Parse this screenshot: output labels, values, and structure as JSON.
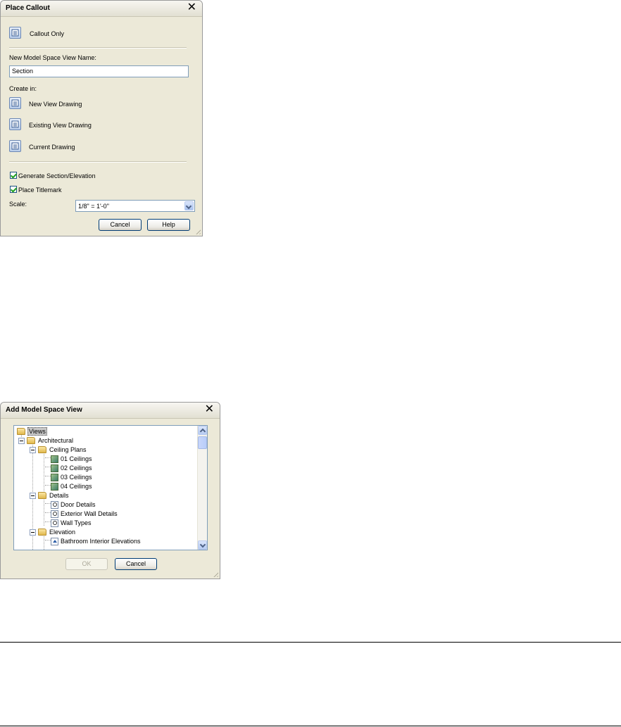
{
  "place_callout": {
    "title": "Place Callout",
    "callout_only_label": "Callout Only",
    "view_name_label": "New Model Space View Name:",
    "view_name_value": "Section",
    "create_in_label": "Create in:",
    "create_options": [
      "New View Drawing",
      "Existing View Drawing",
      "Current Drawing"
    ],
    "generate_section_label": "Generate Section/Elevation",
    "generate_section_checked": true,
    "place_titlemark_label": "Place Titlemark",
    "place_titlemark_checked": true,
    "scale_label": "Scale:",
    "scale_value": "1/8\" = 1'-0\"",
    "cancel_label": "Cancel",
    "help_label": "Help"
  },
  "add_view": {
    "title": "Add Model Space View",
    "tree": {
      "root": "Views",
      "architectural": "Architectural",
      "ceiling_plans": "Ceiling Plans",
      "ceilings": [
        "01 Ceilings",
        "02 Ceilings",
        "03 Ceilings",
        "04 Ceilings"
      ],
      "details": "Details",
      "detail_items": [
        "Door Details",
        "Exterior Wall Details",
        "Wall Types"
      ],
      "elevation": "Elevation",
      "elevation_items": [
        "Bathroom Interior Elevations"
      ]
    },
    "ok_label": "OK",
    "ok_enabled": false,
    "cancel_label": "Cancel"
  },
  "icons": {
    "close": "close-icon",
    "view_drawing": "view-drawing-icon",
    "folder": "folder-icon"
  }
}
